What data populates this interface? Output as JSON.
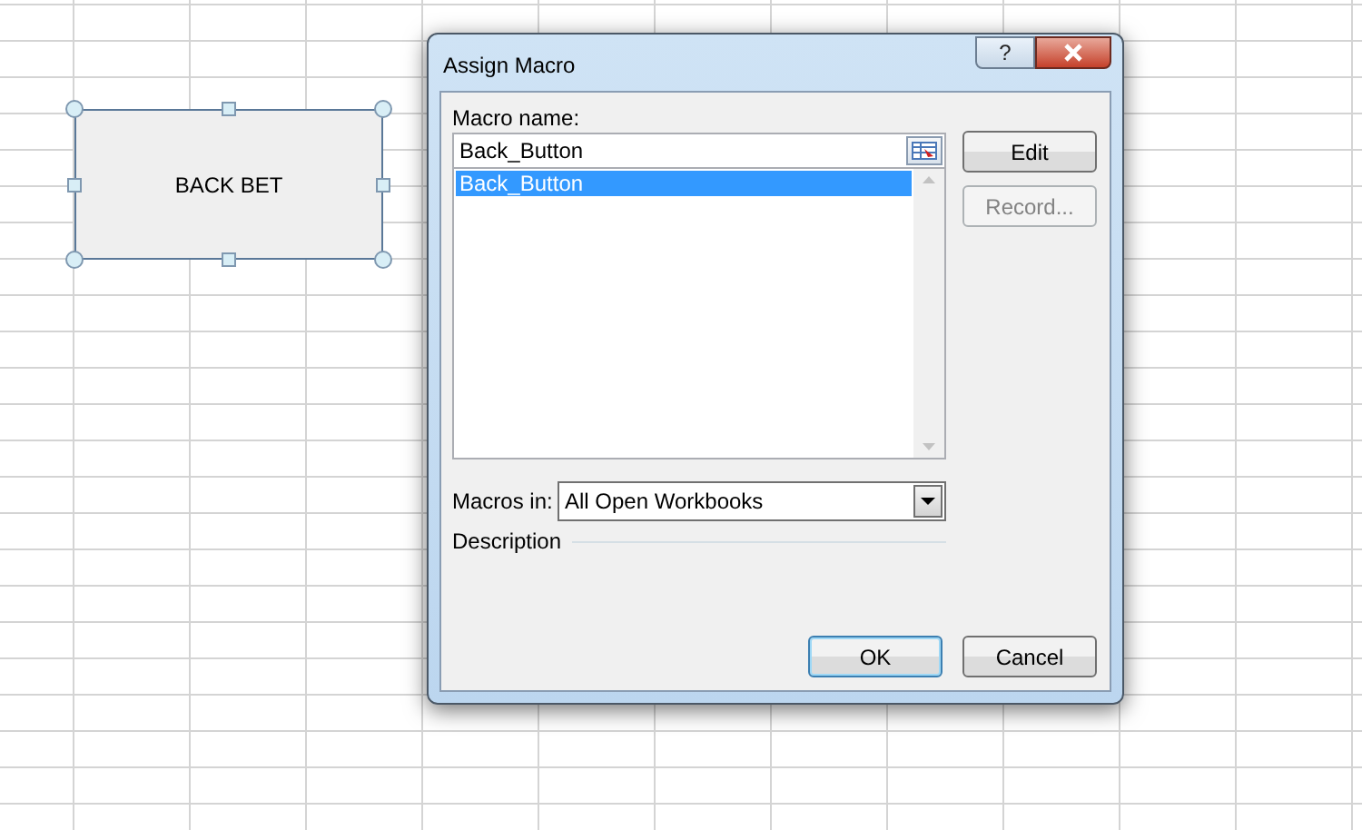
{
  "spreadsheet": {
    "shape": {
      "label": "BACK BET",
      "selected": true
    }
  },
  "dialog": {
    "title": "Assign Macro",
    "help_label": "?",
    "macro_name": {
      "label": "Macro name:",
      "value": "Back_Button"
    },
    "macros": [
      {
        "label": "Back_Button",
        "selected": true
      }
    ],
    "side_buttons": [
      {
        "label": "Edit",
        "disabled": false
      },
      {
        "label": "Record...",
        "disabled": true
      }
    ],
    "macros_in": {
      "label": "Macros in:",
      "value": "All Open Workbooks"
    },
    "description": {
      "label": "Description"
    },
    "buttons": [
      {
        "label": "OK",
        "default": true
      },
      {
        "label": "Cancel",
        "default": false
      }
    ]
  }
}
